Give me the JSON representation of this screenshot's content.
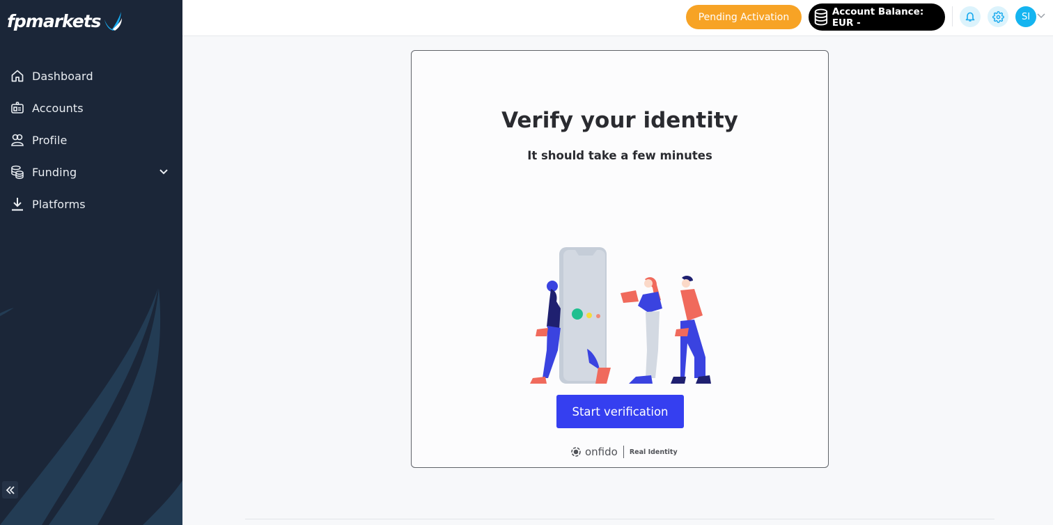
{
  "brand": {
    "name": "fpmarkets",
    "accent": "#17a9ee",
    "sidebar_bg": "#1b2638"
  },
  "sidebar": {
    "items": [
      {
        "label": "Dashboard",
        "icon": "home-icon"
      },
      {
        "label": "Accounts",
        "icon": "id-card-icon"
      },
      {
        "label": "Profile",
        "icon": "users-icon"
      },
      {
        "label": "Funding",
        "icon": "coins-icon",
        "expandable": true
      },
      {
        "label": "Platforms",
        "icon": "download-icon"
      }
    ],
    "collapse_icon": "double-chevron-left-icon"
  },
  "topbar": {
    "status_label": "Pending Activation",
    "status_color": "#f7a325",
    "balance_label": "Account Balance: EUR -",
    "notifications_icon": "bell-icon",
    "settings_icon": "gear-icon",
    "avatar_initials": "SI"
  },
  "verification": {
    "title": "Verify your identity",
    "subtitle": "It should take a few minutes",
    "button_label": "Start verification",
    "button_color": "#353ff0",
    "provider_name": "onfido",
    "provider_tagline": "Real Identity"
  }
}
